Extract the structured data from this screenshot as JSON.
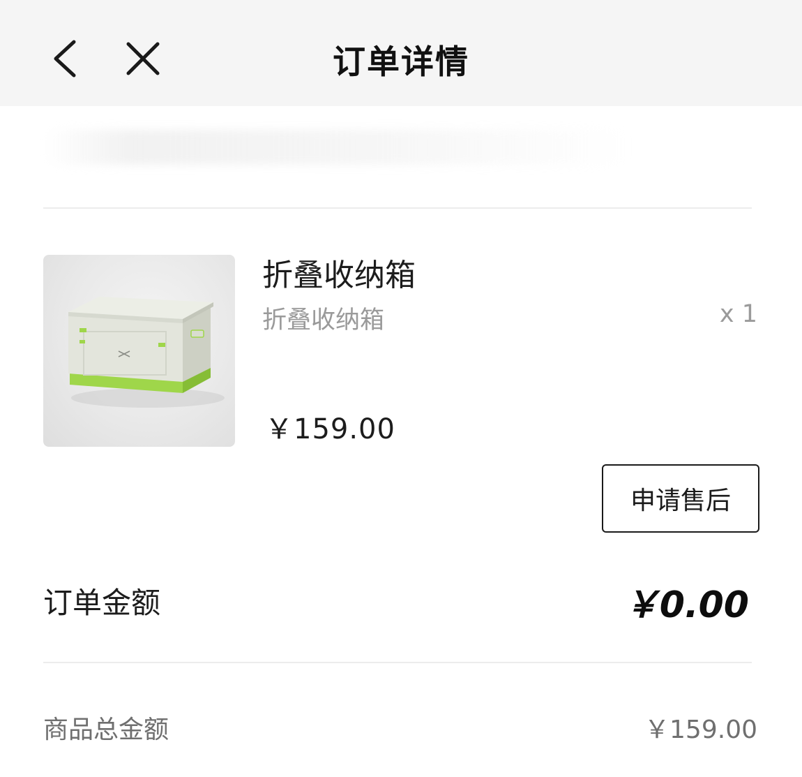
{
  "header": {
    "title": "订单详情",
    "back_icon": "chevron-left-icon",
    "close_icon": "close-icon"
  },
  "product": {
    "name": "折叠收纳箱",
    "spec": "折叠收纳箱",
    "quantity": "x 1",
    "price": "￥159.00",
    "image": "folding-storage-box-image",
    "after_sale_label": "申请售后"
  },
  "summary": {
    "order_amount_label": "订单金额",
    "order_amount_value": "￥0.00",
    "goods_total_label": "商品总金额",
    "goods_total_value": "￥159.00"
  },
  "colors": {
    "header_bg": "#f5f5f5",
    "box_body": "#e6e8df",
    "box_base": "#9fd64a"
  }
}
